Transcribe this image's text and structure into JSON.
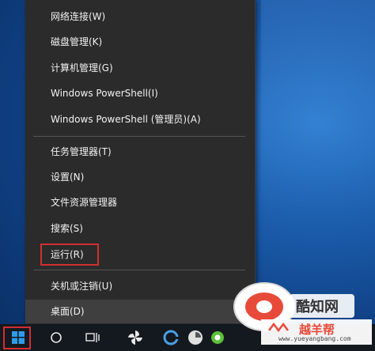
{
  "context_menu": {
    "items": [
      {
        "label": "网络连接(W)"
      },
      {
        "label": "磁盘管理(K)"
      },
      {
        "label": "计算机管理(G)"
      },
      {
        "label": "Windows PowerShell(I)"
      },
      {
        "label": "Windows PowerShell (管理员)(A)"
      },
      {
        "label": "任务管理器(T)"
      },
      {
        "label": "设置(N)"
      },
      {
        "label": "文件资源管理器"
      },
      {
        "label": "搜索(S)"
      },
      {
        "label": "运行(R)"
      },
      {
        "label": "关机或注销(U)"
      },
      {
        "label": "桌面(D)"
      }
    ],
    "highlighted_item": "运行(R)",
    "selected_item": "桌面(D)"
  },
  "taskbar": {
    "icons": [
      "windows-start-icon",
      "search-circle-icon",
      "task-view-icon",
      "pinwheel-app-icon",
      "edge-browser-icon",
      "circular-app-icon",
      "green-app-icon"
    ]
  },
  "watermark": {
    "brand_text": "酷知网",
    "site_text": "越羊帮",
    "url_text": "www.yueyangbang.com"
  },
  "colors": {
    "menu_bg": "#2b2b2b",
    "highlight_border": "#d22f2f",
    "desktop_blue": "#1a5aa8"
  }
}
